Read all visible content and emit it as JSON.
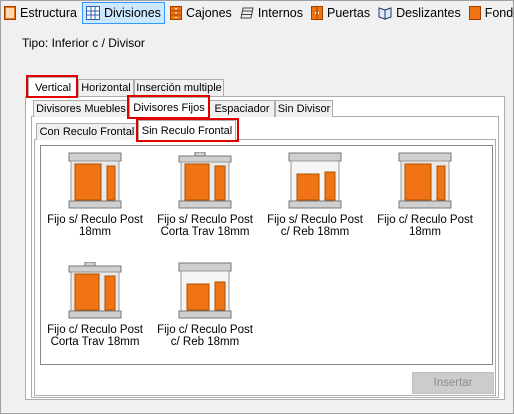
{
  "toolbar": {
    "items": [
      {
        "label": "Estructura",
        "icon": "structure-icon"
      },
      {
        "label": "Divisiones",
        "icon": "grid-icon",
        "selected": true
      },
      {
        "label": "Cajones",
        "icon": "drawers-icon"
      },
      {
        "label": "Internos",
        "icon": "shelves-icon"
      },
      {
        "label": "Puertas",
        "icon": "doors-icon"
      },
      {
        "label": "Deslizantes",
        "icon": "sliding-icon"
      },
      {
        "label": "Fondos",
        "icon": "back-panel-icon"
      }
    ]
  },
  "tipo_label": "Tipo: Inferior c / Divisor",
  "tabs_level1": [
    "Vertical",
    "Horizontal",
    "Inserción multiple"
  ],
  "tabs_level2": [
    "Divisores Muebles",
    "Divisores Fijos",
    "Espaciador",
    "Sin Divisor"
  ],
  "tabs_level3": [
    "Con Reculo Frontal",
    "Sin Reculo Frontal"
  ],
  "items": [
    {
      "line1": "Fijo s/ Reculo Post",
      "line2": "18mm"
    },
    {
      "line1": "Fijo s/ Reculo Post",
      "line2": "Corta Trav 18mm"
    },
    {
      "line1": "Fijo s/ Reculo Post",
      "line2": "c/ Reb 18mm"
    },
    {
      "line1": "Fijo c/ Reculo Post",
      "line2": "18mm"
    },
    {
      "line1": "Fijo c/ Reculo Post",
      "line2": "Corta Trav 18mm"
    },
    {
      "line1": "Fijo c/ Reculo Post",
      "line2": "c/ Reb 18mm"
    }
  ],
  "insert_button": "Insertar",
  "colors": {
    "accent_orange": "#f07414",
    "highlight_red": "#e00000",
    "selection_blue": "#cce8ff"
  }
}
